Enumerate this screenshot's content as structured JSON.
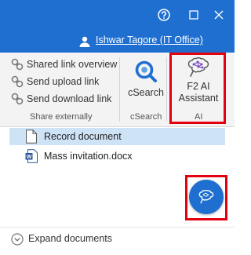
{
  "window": {
    "buttons": [
      {
        "icon": "question-icon"
      },
      {
        "icon": "maximize-icon"
      },
      {
        "icon": "close-icon"
      }
    ],
    "user": {
      "icon": "user-icon",
      "name": "Ishwar Tagore (IT Office)"
    }
  },
  "ribbon": {
    "share_group": {
      "items": [
        {
          "icon": "link-icon",
          "label": "Shared link overview"
        },
        {
          "icon": "link-icon",
          "label": "Send upload link"
        },
        {
          "icon": "link-icon",
          "label": "Send download link"
        }
      ],
      "label": "Share externally"
    },
    "csearch_group": {
      "button_label": "cSearch",
      "label": "cSearch",
      "icon": "csearch-icon"
    },
    "ai_group": {
      "button_line1": "F2 AI",
      "button_line2": "Assistant",
      "label": "AI",
      "icon": "brain-icon",
      "highlight_color": "#e3000f"
    }
  },
  "documents": {
    "items": [
      {
        "icon": "document-icon",
        "name": "Record document",
        "selected": true
      },
      {
        "icon": "word-document-icon",
        "name": "Mass invitation.docx",
        "selected": false
      }
    ]
  },
  "fab": {
    "icon": "brain-icon"
  },
  "footer": {
    "icon": "chevron-down-circle-icon",
    "label": "Expand documents"
  },
  "colors": {
    "accent": "#1e6fd0",
    "selection": "#cfe3f7",
    "highlight": "#e3000f"
  }
}
